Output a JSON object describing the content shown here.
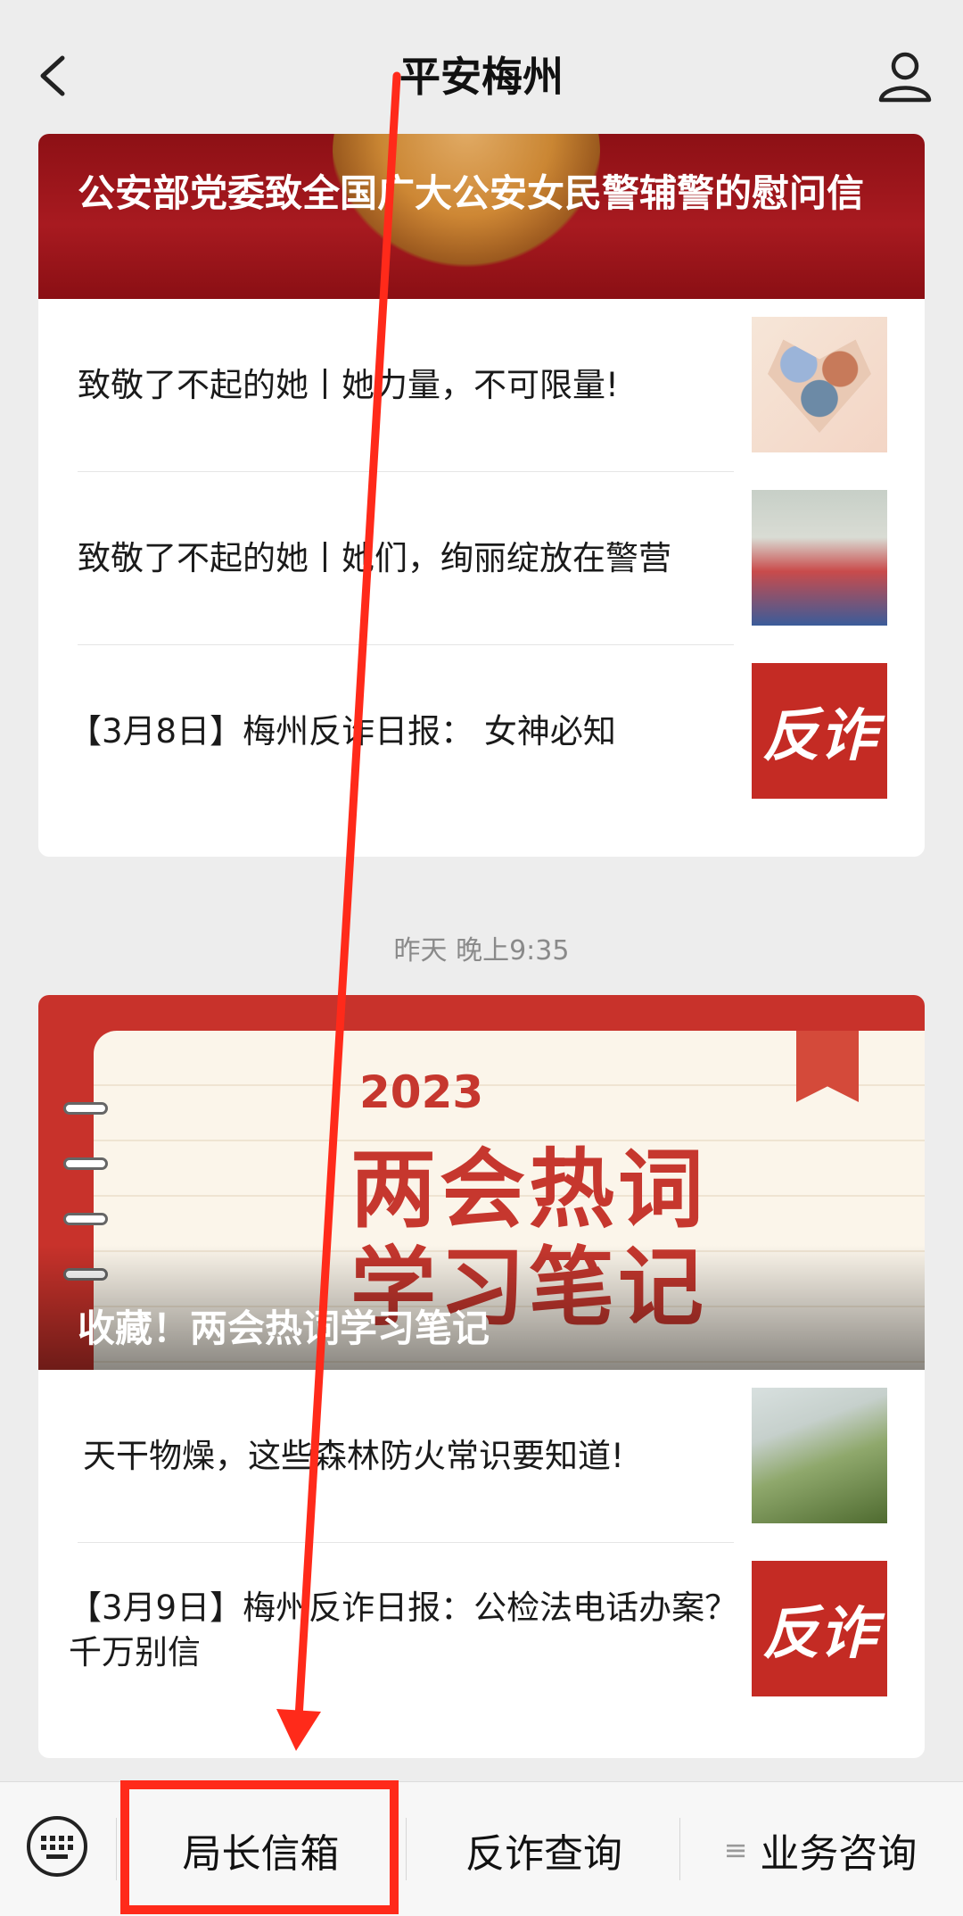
{
  "header": {
    "title": "平安梅州"
  },
  "card1": {
    "cover_title": "公安部党委致全国广大公安女民警辅警的慰问信",
    "articles": [
      {
        "title": "致敬了不起的她丨她力量，不可限量!"
      },
      {
        "title": "致敬了不起的她丨她们，绚丽绽放在警营"
      },
      {
        "title": "【3月8日】梅州反诈日报：  女神必知",
        "thumb_text": "反诈"
      }
    ]
  },
  "timestamp": "昨天 晚上9:35",
  "card2": {
    "cover_year": "2023",
    "cover_line1": "两会热词",
    "cover_line2": "学习笔记",
    "cover_title": "收藏！两会热词学习笔记",
    "articles": [
      {
        "title": "天干物燥，这些森林防火常识要知道!"
      },
      {
        "title": "【3月9日】梅州反诈日报：公检法电话办案？千万别信",
        "thumb_text": "反诈"
      }
    ]
  },
  "menu": {
    "items": [
      {
        "label": "局长信箱"
      },
      {
        "label": "反诈查询"
      },
      {
        "label": "业务咨询"
      }
    ]
  },
  "annotation_color": "#ff2a1a"
}
